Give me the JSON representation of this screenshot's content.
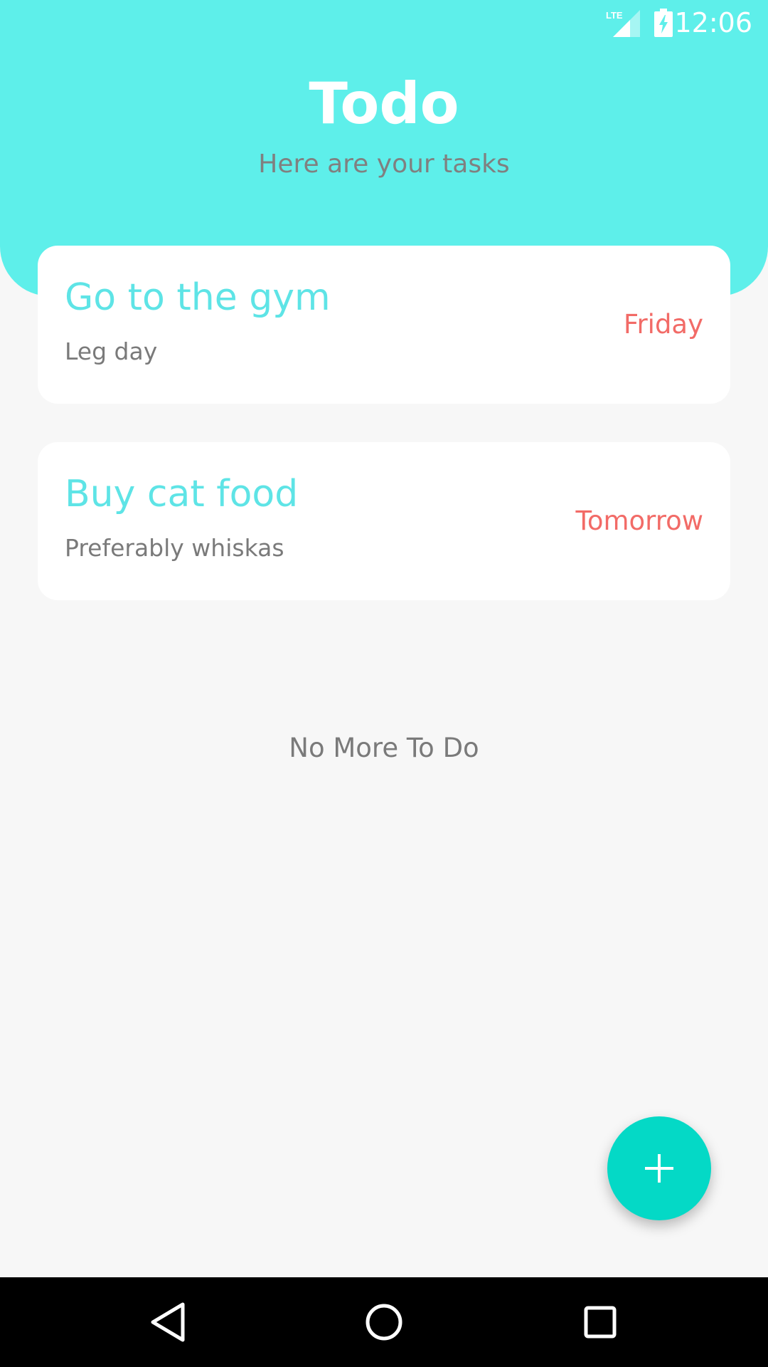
{
  "status_bar": {
    "time": "12:06",
    "network_label": "LTE",
    "icons": [
      "lte-signal-icon",
      "battery-charging-icon"
    ]
  },
  "header": {
    "title": "Todo",
    "subtitle": "Here are your tasks"
  },
  "tasks": [
    {
      "title": "Go to the gym",
      "note": "Leg day",
      "due": "Friday"
    },
    {
      "title": "Buy cat food",
      "note": "Preferably whiskas",
      "due": "Tomorrow"
    }
  ],
  "empty_message": "No More To Do",
  "fab": {
    "icon": "plus-icon"
  },
  "nav_bar": {
    "icons": [
      "back-icon",
      "home-icon",
      "recent-apps-icon"
    ]
  },
  "colors": {
    "header_bg": "#5eefea",
    "task_title": "#5ee4e6",
    "due_date": "#f26b67",
    "fab": "#04d9c6",
    "page_bg": "#f7f7f7"
  }
}
